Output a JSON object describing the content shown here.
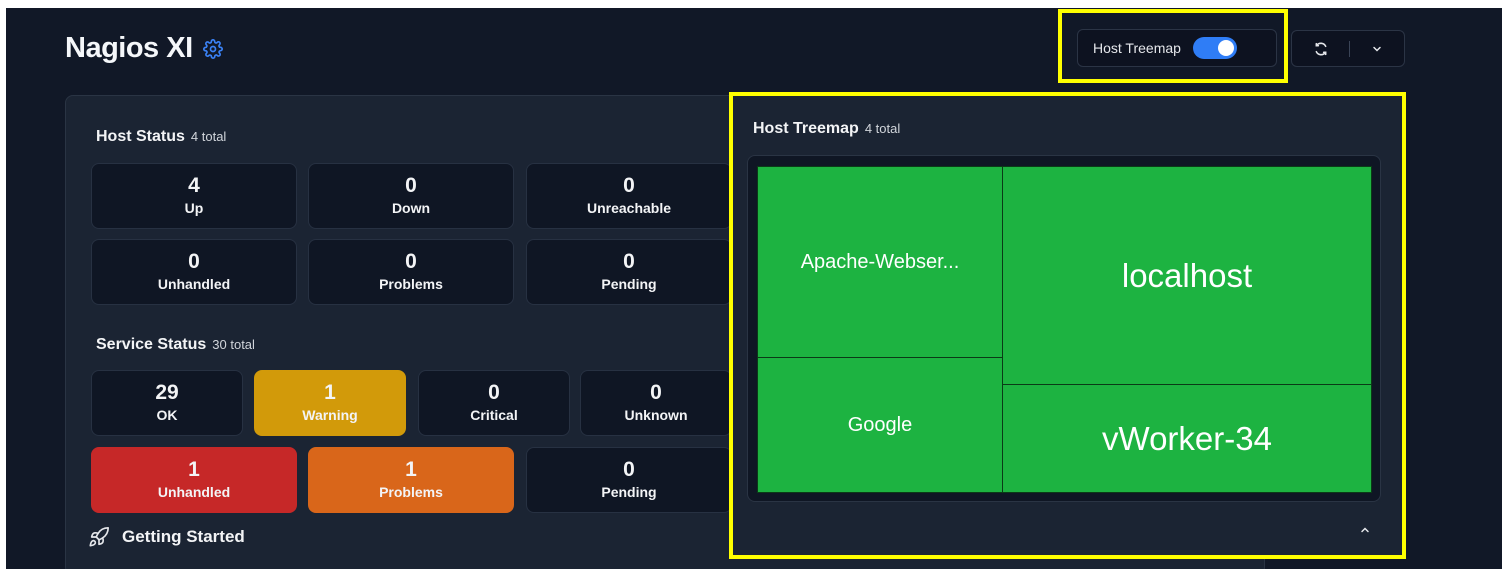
{
  "header": {
    "title": "Nagios XI",
    "settings_icon": "gear-icon"
  },
  "toolbar": {
    "treemap_toggle_label": "Host Treemap",
    "treemap_toggle_on": true,
    "refresh_icon": "refresh-icon",
    "more_icon": "chevron-down-icon"
  },
  "host_status": {
    "title": "Host Status",
    "count": "4 total",
    "tiles": [
      {
        "value": "4",
        "label": "Up"
      },
      {
        "value": "0",
        "label": "Down"
      },
      {
        "value": "0",
        "label": "Unreachable"
      },
      {
        "value": "0",
        "label": "Unhandled"
      },
      {
        "value": "0",
        "label": "Problems"
      },
      {
        "value": "0",
        "label": "Pending"
      }
    ]
  },
  "service_status": {
    "title": "Service Status",
    "count": "30 total",
    "tiles": [
      {
        "value": "29",
        "label": "OK"
      },
      {
        "value": "1",
        "label": "Warning"
      },
      {
        "value": "0",
        "label": "Critical"
      },
      {
        "value": "0",
        "label": "Unknown"
      },
      {
        "value": "1",
        "label": "Unhandled"
      },
      {
        "value": "1",
        "label": "Problems"
      },
      {
        "value": "0",
        "label": "Pending"
      }
    ]
  },
  "getting_started": {
    "label": "Getting Started",
    "icon": "rocket-icon"
  },
  "treemap": {
    "title": "Host Treemap",
    "count": "4 total",
    "hosts": [
      "Apache-Webser...",
      "localhost",
      "Google",
      "vWorker-34"
    ],
    "cell_color": "#1db341",
    "collapse_icon": "chevron-up-icon"
  },
  "colors": {
    "background": "#111827",
    "card": "#1b2433",
    "accent": "#2f7df6",
    "warning": "#d29a0a",
    "danger": "#c62828",
    "orange": "#d9661a",
    "highlight": "#ffff00"
  }
}
